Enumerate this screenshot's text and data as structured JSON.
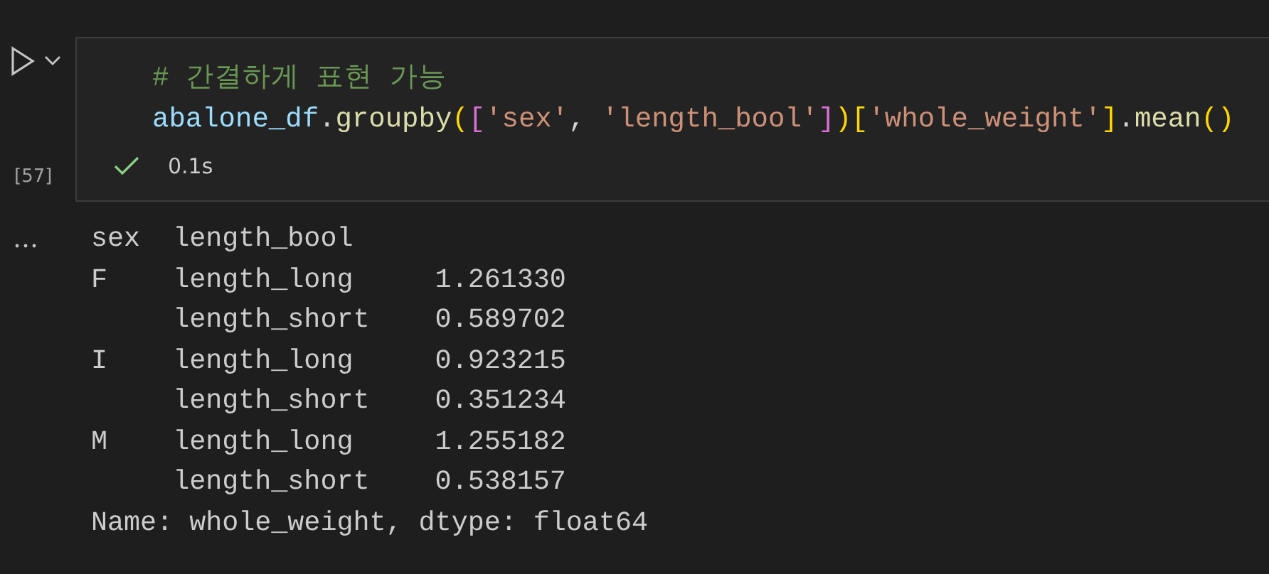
{
  "cell": {
    "execution_count": "[57]",
    "status": {
      "succeeded": true,
      "duration": "0.1s"
    },
    "code_lines": [
      [
        {
          "kind": "comment",
          "text": "# 간결하게 표현 가능"
        }
      ],
      [
        {
          "kind": "var",
          "text": "abalone_df"
        },
        {
          "kind": "punct",
          "text": "."
        },
        {
          "kind": "func",
          "text": "groupby"
        },
        {
          "kind": "bracket1",
          "text": "("
        },
        {
          "kind": "bracket2",
          "text": "["
        },
        {
          "kind": "string",
          "text": "'sex'"
        },
        {
          "kind": "punct",
          "text": ", "
        },
        {
          "kind": "string",
          "text": "'length_bool'"
        },
        {
          "kind": "bracket2",
          "text": "]"
        },
        {
          "kind": "bracket1",
          "text": ")"
        },
        {
          "kind": "bracket1",
          "text": "["
        },
        {
          "kind": "string",
          "text": "'whole_weight'"
        },
        {
          "kind": "bracket1",
          "text": "]"
        },
        {
          "kind": "punct",
          "text": "."
        },
        {
          "kind": "func",
          "text": "mean"
        },
        {
          "kind": "bracket1",
          "text": "()"
        }
      ]
    ]
  },
  "output": {
    "lines": [
      "sex  length_bool",
      "F    length_long     1.261330",
      "     length_short    0.589702",
      "I    length_long     0.923215",
      "     length_short    0.351234",
      "M    length_long     1.255182",
      "     length_short    0.538157",
      "Name: whole_weight, dtype: float64"
    ]
  }
}
